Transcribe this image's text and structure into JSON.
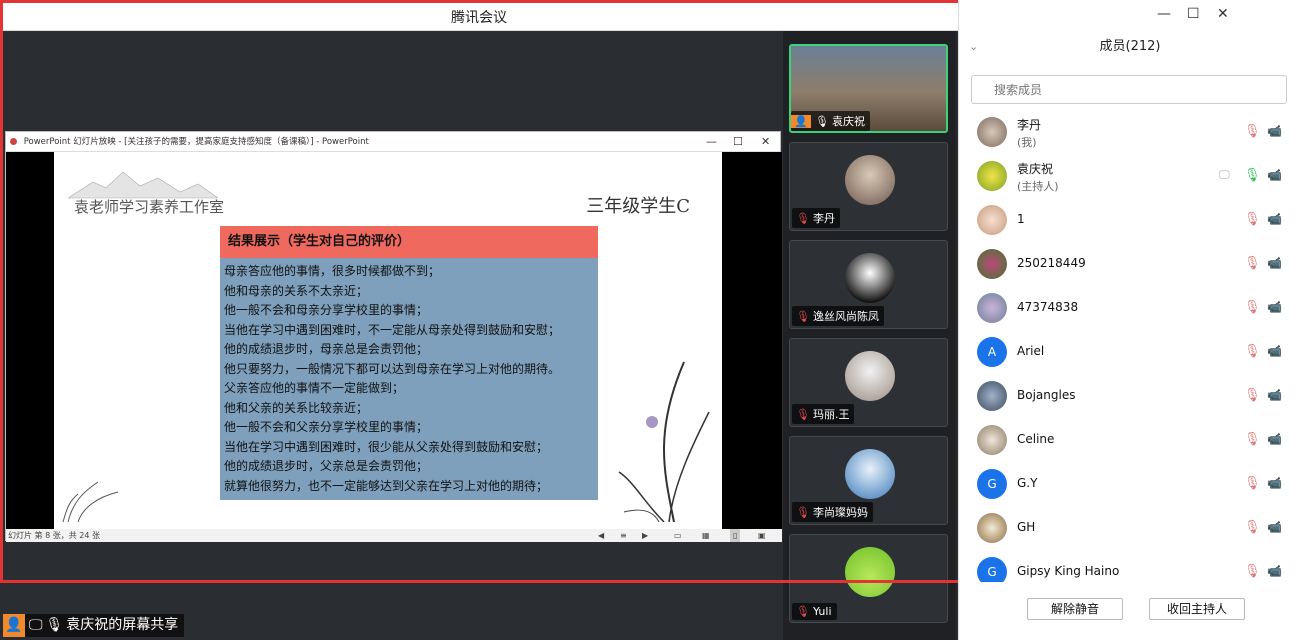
{
  "window": {
    "title": "腾讯会议"
  },
  "ppt": {
    "title": "PowerPoint 幻灯片放映 - [关注孩子的需要，提高家庭支持感知度（备课稿）] - PowerPoint",
    "status": "幻灯片 第 8 张，共 24 张"
  },
  "slide": {
    "studio": "袁老师学习素养工作室",
    "grade": "三年级学生C",
    "result_title": "结果展示（学生对自己的评价）",
    "lines": [
      "母亲答应他的事情，很多时候都做不到；",
      "他和母亲的关系不太亲近；",
      "他一般不会和母亲分享学校里的事情；",
      "当他在学习中遇到困难时，不一定能从母亲处得到鼓励和安慰；",
      "他的成绩退步时，母亲总是会责罚他；",
      "他只要努力，一般情况下都可以达到母亲在学习上对他的期待。",
      "父亲答应他的事情不一定能做到；",
      "他和父亲的关系比较亲近；",
      "他一般不会和父亲分享学校里的事情；",
      "当他在学习中遇到困难时，很少能从父亲处得到鼓励和安慰；",
      "他的成绩退步时，父亲总是会责罚他；",
      "就算他很努力，也不一定能够达到父亲在学习上对他的期待；"
    ]
  },
  "video_tiles": [
    {
      "name": "袁庆祝"
    },
    {
      "name": "李丹"
    },
    {
      "name": "逸丝风尚陈凤"
    },
    {
      "name": "玛丽.王"
    },
    {
      "name": "李尚璨妈妈"
    },
    {
      "name": "Yuli"
    }
  ],
  "share_bar": {
    "label": "袁庆祝的屏幕共享"
  },
  "panel": {
    "header": "成员(212)",
    "search_placeholder": "搜索成员",
    "members": [
      {
        "name": "李丹",
        "role": "(我)"
      },
      {
        "name": "袁庆祝",
        "role": "(主持人)"
      },
      {
        "name": "1"
      },
      {
        "name": "250218449"
      },
      {
        "name": "47374838"
      },
      {
        "name": "Ariel",
        "initial": "A"
      },
      {
        "name": "Bojangles"
      },
      {
        "name": "Celine"
      },
      {
        "name": "G.Y",
        "initial": "G"
      },
      {
        "name": "GH"
      },
      {
        "name": "Gipsy King Haino",
        "initial": "G"
      }
    ],
    "unmute_label": "解除静音",
    "reclaim_host_label": "收回主持人"
  },
  "colors": {
    "accent": "#1a73e8",
    "red_frame": "#e33434",
    "active_tile": "#3fd07a"
  }
}
